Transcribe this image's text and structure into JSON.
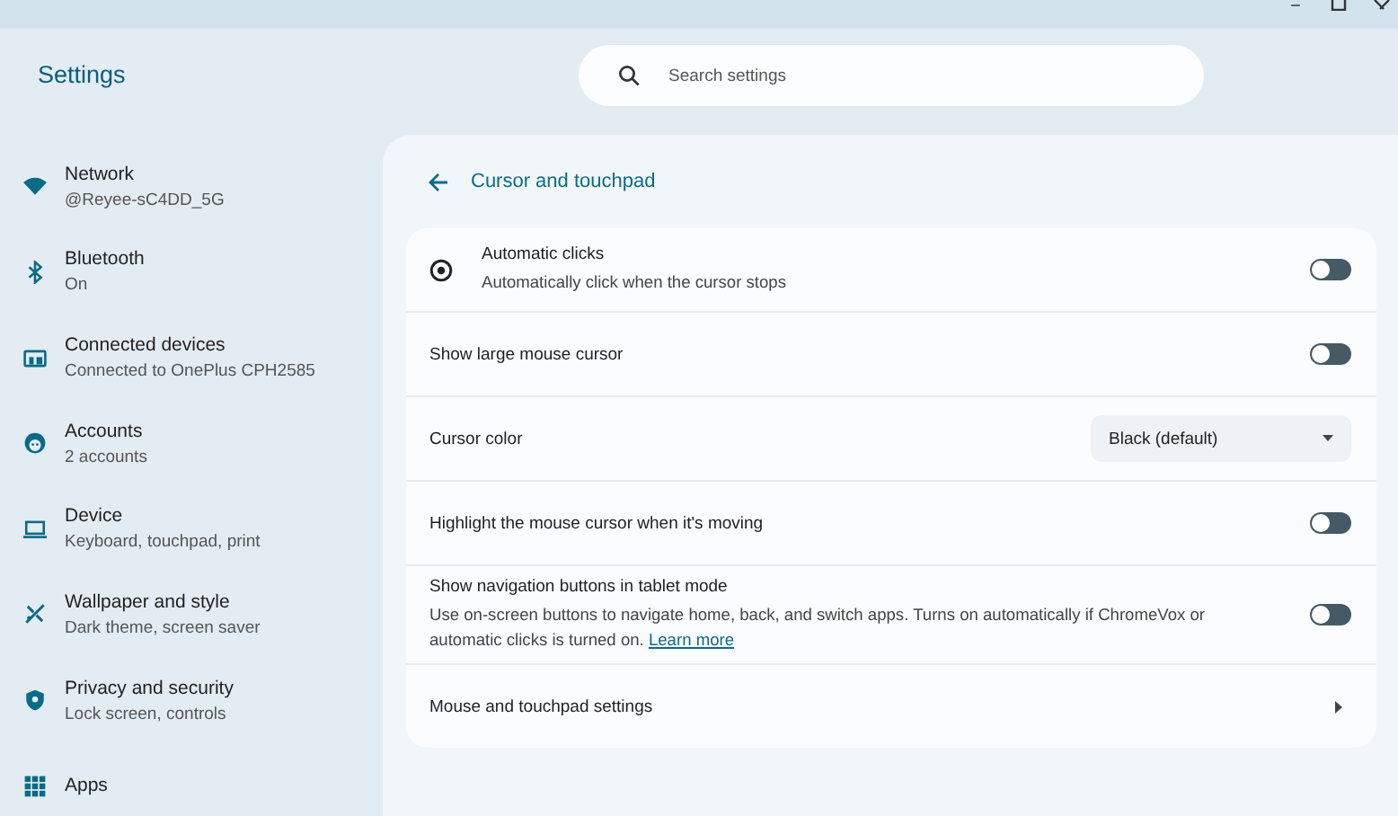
{
  "app_title": "Settings",
  "search": {
    "placeholder": "Search settings"
  },
  "sidebar": {
    "items": [
      {
        "title": "Network",
        "subtitle": "@Reyee-sC4DD_5G",
        "selected": false
      },
      {
        "title": "Bluetooth",
        "subtitle": "On",
        "selected": false
      },
      {
        "title": "Connected devices",
        "subtitle": "Connected to OnePlus CPH2585",
        "selected": false
      },
      {
        "title": "Accounts",
        "subtitle": "2 accounts",
        "selected": false
      },
      {
        "title": "Device",
        "subtitle": "Keyboard, touchpad, print",
        "selected": false
      },
      {
        "title": "Wallpaper and style",
        "subtitle": "Dark theme, screen saver",
        "selected": false
      },
      {
        "title": "Privacy and security",
        "subtitle": "Lock screen, controls",
        "selected": false
      },
      {
        "title": "Apps",
        "selected": false
      }
    ]
  },
  "page": {
    "title": "Cursor and touchpad",
    "rows": [
      {
        "kind": "toggle",
        "label": "Automatic clicks",
        "description": "Automatically click when the cursor stops",
        "on": false
      },
      {
        "kind": "toggle",
        "label": "Show large mouse cursor",
        "on": false
      },
      {
        "kind": "select",
        "label": "Cursor color",
        "value": "Black (default)"
      },
      {
        "kind": "toggle",
        "label": "Highlight the mouse cursor when it's moving",
        "on": false
      },
      {
        "kind": "toggle",
        "label": "Show navigation buttons in tablet mode",
        "description": "Use on-screen buttons to navigate home, back, and switch apps. Turns on automatically if ChromeVox or automatic clicks is turned on.",
        "link": "Learn more",
        "on": false
      },
      {
        "kind": "link",
        "label": "Mouse and touchpad settings"
      }
    ]
  }
}
